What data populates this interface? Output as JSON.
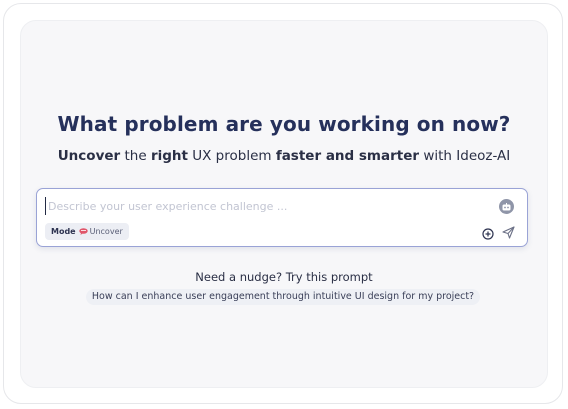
{
  "heading": {
    "title": "What problem are you working on now?",
    "subtitle": {
      "part1": "Uncover",
      "part2": " the ",
      "part3": "right",
      "part4": " UX problem ",
      "part5": "faster and smarter",
      "part6": " with Ideoz-AI"
    }
  },
  "prompt": {
    "placeholder": "Describe your user experience challenge ...",
    "value": "",
    "mode_label": "Mode",
    "mode_value": "Uncover",
    "icons": {
      "assistant": "robot-icon",
      "mode": "speech-bubble-icon",
      "add": "plus-circle-icon",
      "send": "send-icon"
    }
  },
  "nudge": {
    "title": "Need a nudge? Try this prompt",
    "suggestion": "How can I enhance user engagement through intuitive UI design for my project?"
  },
  "colors": {
    "heading": "#25305b",
    "accent_border": "#9aa3d6",
    "panel_bg": "#f7f7f9",
    "chip_bg": "#eceef4",
    "mode_bubble": "#e0566a"
  }
}
